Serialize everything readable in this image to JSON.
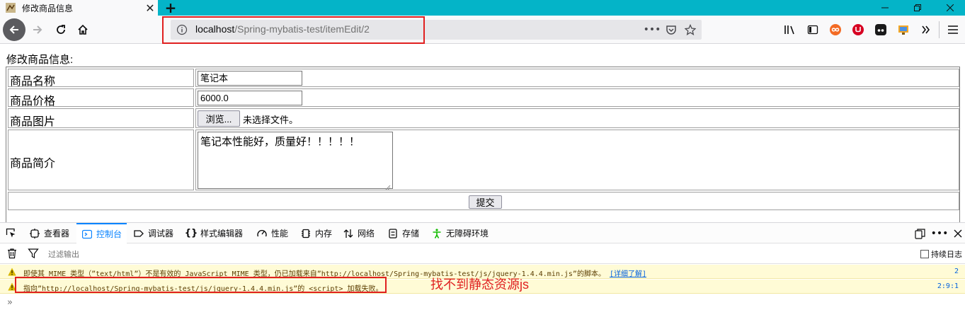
{
  "browser": {
    "tab_title": "修改商品信息",
    "url_host": "localhost",
    "url_path": "/Spring-mybatis-test/itemEdit/2"
  },
  "page": {
    "heading": "修改商品信息:",
    "rows": [
      {
        "label": "商品名称",
        "value": "笔记本"
      },
      {
        "label": "商品价格",
        "value": "6000.0"
      },
      {
        "label": "商品图片",
        "button": "浏览...",
        "status": "未选择文件。"
      },
      {
        "label": "商品简介",
        "value": "笔记本性能好，质量好！！！！！"
      }
    ],
    "submit_label": "提交"
  },
  "devtools": {
    "tabs": {
      "inspector": "查看器",
      "console": "控制台",
      "debugger": "调试器",
      "style_editor": "样式编辑器",
      "performance": "性能",
      "memory": "内存",
      "network": "网络",
      "storage": "存储",
      "accessibility": "无障碍环境"
    },
    "filter_placeholder": "过滤输出",
    "persist_logs": "持续日志",
    "messages": [
      {
        "text": "即使其 MIME 类型（”text/html”）不是有效的 JavaScript MIME 类型，仍已加载来自”http://localhost/Spring-mybatis-test/js/jquery-1.4.4.min.js”的脚本。",
        "link": "[详细了解]",
        "location": "2"
      },
      {
        "text": "指向”http://localhost/Spring-mybatis-test/js/jquery-1.4.4.min.js”的 <script> 加载失败。",
        "location": "2:9:1"
      }
    ],
    "prompt": "»"
  },
  "annotation": "找不到静态资源js",
  "colors": {
    "tab_strip": "#04b4c8",
    "highlight": "#e02020",
    "devtools_accent": "#0a84ff",
    "warning_bg": "#fffbd6"
  }
}
